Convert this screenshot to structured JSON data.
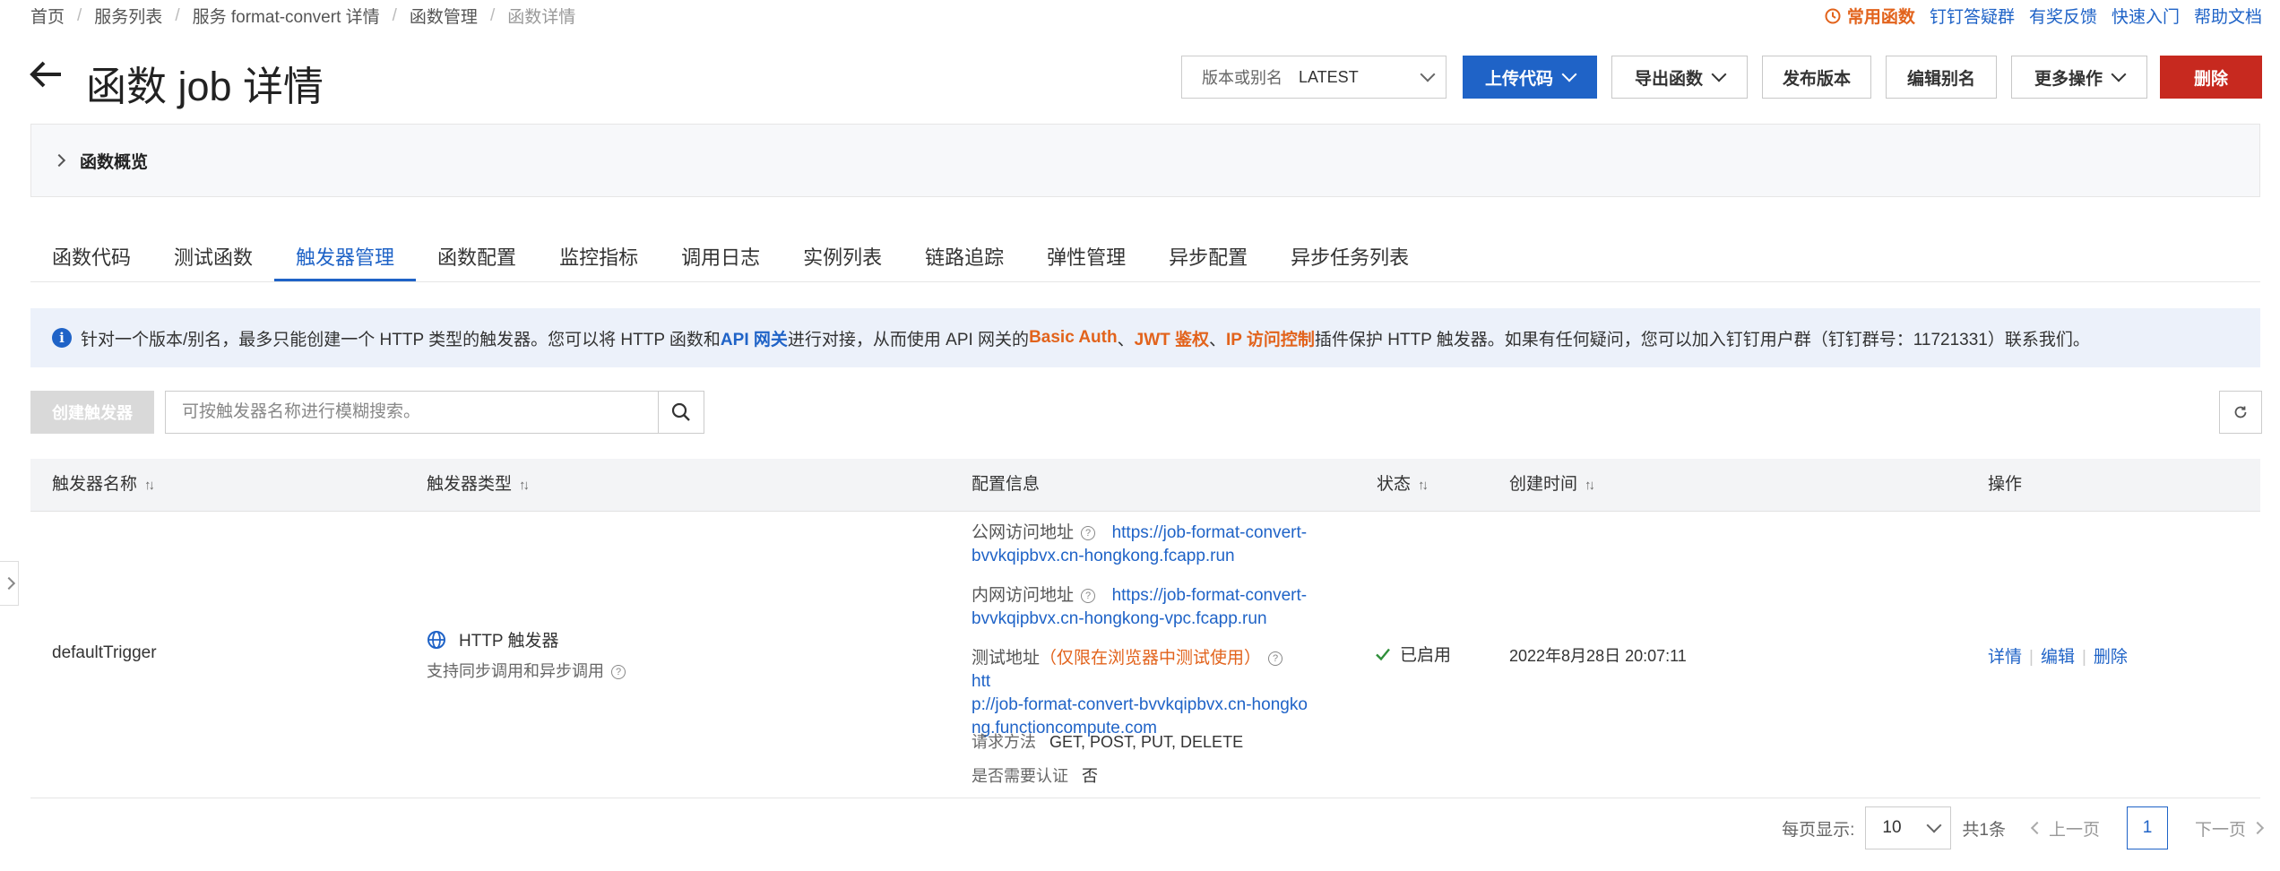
{
  "breadcrumb": {
    "items": [
      "首页",
      "服务列表",
      "服务 format-convert 详情",
      "函数管理"
    ],
    "current": "函数详情"
  },
  "top_links": {
    "hot": "常用函数",
    "items": [
      "钉钉答疑群",
      "有奖反馈",
      "快速入门",
      "帮助文档"
    ]
  },
  "header": {
    "title": "函数 job 详情",
    "version_label": "版本或别名",
    "version_value": "LATEST",
    "buttons": {
      "upload": "上传代码",
      "export": "导出函数",
      "publish": "发布版本",
      "edit_alias": "编辑别名",
      "more": "更多操作",
      "delete": "删除"
    }
  },
  "overview": {
    "label": "函数概览"
  },
  "tabs": [
    "函数代码",
    "测试函数",
    "触发器管理",
    "函数配置",
    "监控指标",
    "调用日志",
    "实例列表",
    "链路追踪",
    "弹性管理",
    "异步配置",
    "异步任务列表"
  ],
  "active_tab": "触发器管理",
  "info_banner": {
    "text1": "针对一个版本/别名，最多只能创建一个 HTTP 类型的触发器。您可以将 HTTP 函数和 ",
    "link1": "API 网关",
    "text2": "进行对接，从而使用 API 网关的 ",
    "link2": "Basic Auth",
    "text3": "、",
    "link3": "JWT 鉴权",
    "text4": "、",
    "link4": "IP 访问控制",
    "text5": "插件保护 HTTP 触发器。如果有任何疑问，您可以加入钉钉用户群（钉钉群号：11721331）联系我们。"
  },
  "toolbar": {
    "create_label": "创建触发器",
    "search_placeholder": "可按触发器名称进行模糊搜索。"
  },
  "table": {
    "columns": {
      "name": "触发器名称",
      "type": "触发器类型",
      "config": "配置信息",
      "status": "状态",
      "created": "创建时间",
      "actions": "操作"
    },
    "row": {
      "name": "defaultTrigger",
      "type": "HTTP 触发器",
      "type_desc": "支持同步调用和异步调用",
      "public_label": "公网访问地址",
      "public_url_1": "https://job-format-convert-",
      "public_url_2": "bvvkqipbvx.cn-hongkong.fcapp.run",
      "internal_label": "内网访问地址",
      "internal_url_1": "https://job-format-convert-",
      "internal_url_2": "bvvkqipbvx.cn-hongkong-vpc.fcapp.run",
      "test_label": "测试地址",
      "test_note": "（仅限在浏览器中测试使用）",
      "test_url_1": "htt",
      "test_url_2": "p://job-format-convert-bvvkqipbvx.cn-hongko",
      "test_url_3": "ng.functioncompute.com",
      "method_label": "请求方法",
      "method_value": "GET, POST, PUT, DELETE",
      "auth_label": "是否需要认证",
      "auth_value": "否",
      "status": "已启用",
      "created": "2022年8月28日 20:07:11",
      "action_detail": "详情",
      "action_edit": "编辑",
      "action_delete": "删除"
    }
  },
  "pagination": {
    "per_page_label": "每页显示:",
    "per_page_value": "10",
    "total": "共1条",
    "prev": "上一页",
    "page": "1",
    "next": "下一页"
  },
  "colors": {
    "primary": "#1f63c7",
    "danger": "#c7291f",
    "accent": "#e2631c",
    "success": "#2f8f3a"
  }
}
